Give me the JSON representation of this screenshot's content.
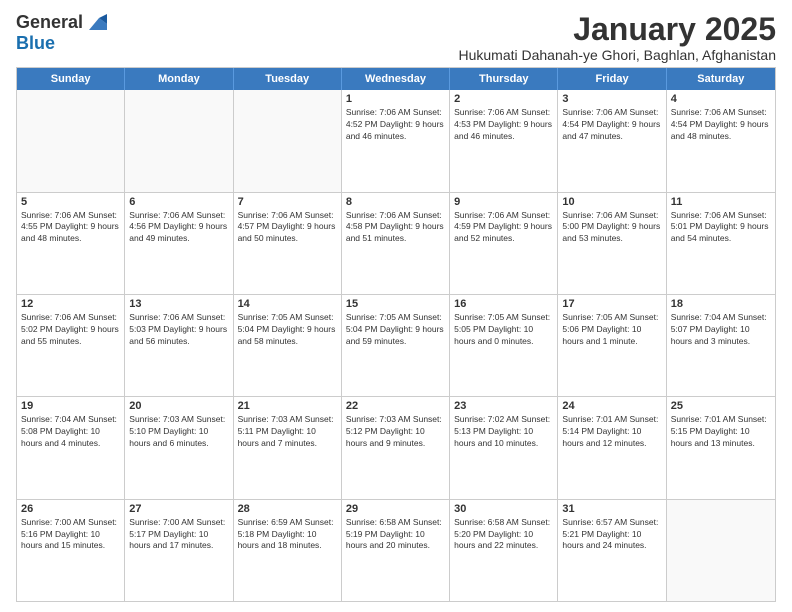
{
  "logo": {
    "general": "General",
    "blue": "Blue"
  },
  "title": "January 2025",
  "location": "Hukumati Dahanah-ye Ghori, Baghlan, Afghanistan",
  "weekdays": [
    "Sunday",
    "Monday",
    "Tuesday",
    "Wednesday",
    "Thursday",
    "Friday",
    "Saturday"
  ],
  "weeks": [
    [
      {
        "day": "",
        "info": ""
      },
      {
        "day": "",
        "info": ""
      },
      {
        "day": "",
        "info": ""
      },
      {
        "day": "1",
        "info": "Sunrise: 7:06 AM\nSunset: 4:52 PM\nDaylight: 9 hours and 46 minutes."
      },
      {
        "day": "2",
        "info": "Sunrise: 7:06 AM\nSunset: 4:53 PM\nDaylight: 9 hours and 46 minutes."
      },
      {
        "day": "3",
        "info": "Sunrise: 7:06 AM\nSunset: 4:54 PM\nDaylight: 9 hours and 47 minutes."
      },
      {
        "day": "4",
        "info": "Sunrise: 7:06 AM\nSunset: 4:54 PM\nDaylight: 9 hours and 48 minutes."
      }
    ],
    [
      {
        "day": "5",
        "info": "Sunrise: 7:06 AM\nSunset: 4:55 PM\nDaylight: 9 hours and 48 minutes."
      },
      {
        "day": "6",
        "info": "Sunrise: 7:06 AM\nSunset: 4:56 PM\nDaylight: 9 hours and 49 minutes."
      },
      {
        "day": "7",
        "info": "Sunrise: 7:06 AM\nSunset: 4:57 PM\nDaylight: 9 hours and 50 minutes."
      },
      {
        "day": "8",
        "info": "Sunrise: 7:06 AM\nSunset: 4:58 PM\nDaylight: 9 hours and 51 minutes."
      },
      {
        "day": "9",
        "info": "Sunrise: 7:06 AM\nSunset: 4:59 PM\nDaylight: 9 hours and 52 minutes."
      },
      {
        "day": "10",
        "info": "Sunrise: 7:06 AM\nSunset: 5:00 PM\nDaylight: 9 hours and 53 minutes."
      },
      {
        "day": "11",
        "info": "Sunrise: 7:06 AM\nSunset: 5:01 PM\nDaylight: 9 hours and 54 minutes."
      }
    ],
    [
      {
        "day": "12",
        "info": "Sunrise: 7:06 AM\nSunset: 5:02 PM\nDaylight: 9 hours and 55 minutes."
      },
      {
        "day": "13",
        "info": "Sunrise: 7:06 AM\nSunset: 5:03 PM\nDaylight: 9 hours and 56 minutes."
      },
      {
        "day": "14",
        "info": "Sunrise: 7:05 AM\nSunset: 5:04 PM\nDaylight: 9 hours and 58 minutes."
      },
      {
        "day": "15",
        "info": "Sunrise: 7:05 AM\nSunset: 5:04 PM\nDaylight: 9 hours and 59 minutes."
      },
      {
        "day": "16",
        "info": "Sunrise: 7:05 AM\nSunset: 5:05 PM\nDaylight: 10 hours and 0 minutes."
      },
      {
        "day": "17",
        "info": "Sunrise: 7:05 AM\nSunset: 5:06 PM\nDaylight: 10 hours and 1 minute."
      },
      {
        "day": "18",
        "info": "Sunrise: 7:04 AM\nSunset: 5:07 PM\nDaylight: 10 hours and 3 minutes."
      }
    ],
    [
      {
        "day": "19",
        "info": "Sunrise: 7:04 AM\nSunset: 5:08 PM\nDaylight: 10 hours and 4 minutes."
      },
      {
        "day": "20",
        "info": "Sunrise: 7:03 AM\nSunset: 5:10 PM\nDaylight: 10 hours and 6 minutes."
      },
      {
        "day": "21",
        "info": "Sunrise: 7:03 AM\nSunset: 5:11 PM\nDaylight: 10 hours and 7 minutes."
      },
      {
        "day": "22",
        "info": "Sunrise: 7:03 AM\nSunset: 5:12 PM\nDaylight: 10 hours and 9 minutes."
      },
      {
        "day": "23",
        "info": "Sunrise: 7:02 AM\nSunset: 5:13 PM\nDaylight: 10 hours and 10 minutes."
      },
      {
        "day": "24",
        "info": "Sunrise: 7:01 AM\nSunset: 5:14 PM\nDaylight: 10 hours and 12 minutes."
      },
      {
        "day": "25",
        "info": "Sunrise: 7:01 AM\nSunset: 5:15 PM\nDaylight: 10 hours and 13 minutes."
      }
    ],
    [
      {
        "day": "26",
        "info": "Sunrise: 7:00 AM\nSunset: 5:16 PM\nDaylight: 10 hours and 15 minutes."
      },
      {
        "day": "27",
        "info": "Sunrise: 7:00 AM\nSunset: 5:17 PM\nDaylight: 10 hours and 17 minutes."
      },
      {
        "day": "28",
        "info": "Sunrise: 6:59 AM\nSunset: 5:18 PM\nDaylight: 10 hours and 18 minutes."
      },
      {
        "day": "29",
        "info": "Sunrise: 6:58 AM\nSunset: 5:19 PM\nDaylight: 10 hours and 20 minutes."
      },
      {
        "day": "30",
        "info": "Sunrise: 6:58 AM\nSunset: 5:20 PM\nDaylight: 10 hours and 22 minutes."
      },
      {
        "day": "31",
        "info": "Sunrise: 6:57 AM\nSunset: 5:21 PM\nDaylight: 10 hours and 24 minutes."
      },
      {
        "day": "",
        "info": ""
      }
    ]
  ]
}
